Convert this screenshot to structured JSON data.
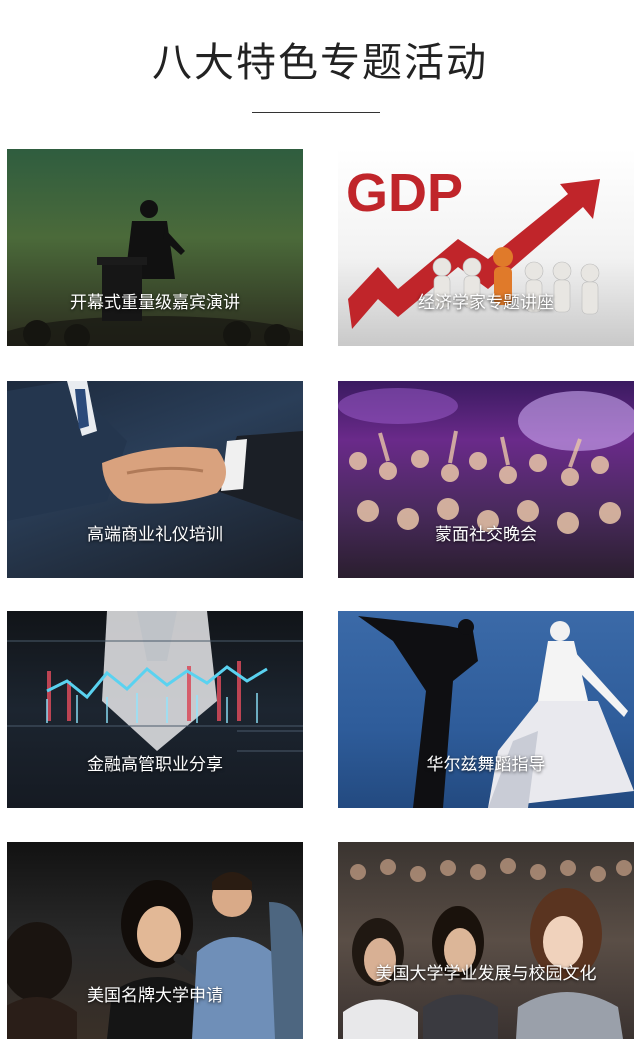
{
  "page": {
    "title": "八大特色专题活动"
  },
  "cards": [
    {
      "label": "开幕式重量级嘉宾演讲",
      "image": "speaker-silhouette-podium"
    },
    {
      "label": "经济学家专题讲座",
      "image": "gdp-rising-arrow-figures",
      "image_text": "GDP"
    },
    {
      "label": "高端商业礼仪培训",
      "image": "business-handshake"
    },
    {
      "label": "蒙面社交晚会",
      "image": "party-crowd-stage-lights"
    },
    {
      "label": "金融高管职业分享",
      "image": "finance-chart-executive"
    },
    {
      "label": "华尔兹舞蹈指导",
      "image": "waltz-dancers"
    },
    {
      "label": "美国名牌大学申请",
      "image": "student-with-microphone"
    },
    {
      "label": "美国大学学业发展与校园文化",
      "image": "audience-students"
    }
  ],
  "colors": {
    "title": "#222222",
    "label": "#ffffff",
    "gdp_red": "#c0252a"
  }
}
